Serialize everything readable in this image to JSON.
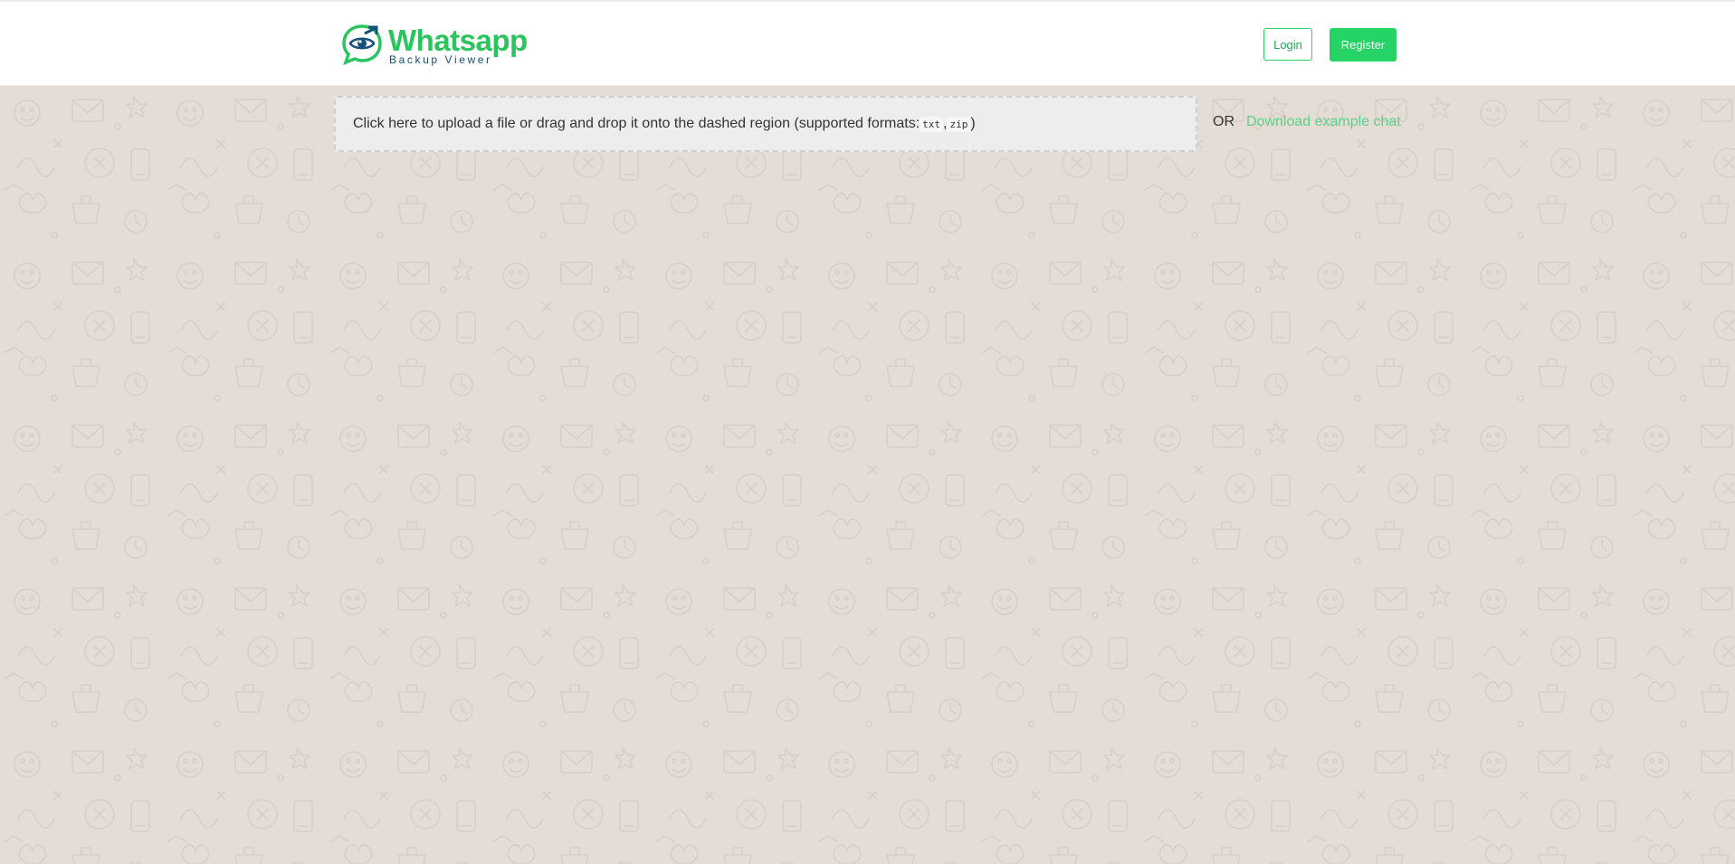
{
  "brand": {
    "title": "Whatsapp",
    "subtitle": "Backup Viewer",
    "logo_icon": "eye-in-chat-bubble-icon",
    "accent_color": "#25d366",
    "dark_color": "#14507a"
  },
  "nav": {
    "login_label": "Login",
    "register_label": "Register"
  },
  "upload": {
    "text": "Click here to upload a file or drag and drop it onto the dashed region (supported formats: ",
    "formats": [
      "txt",
      "zip"
    ],
    "separator": ", ",
    "suffix": ")",
    "or_label": "OR",
    "example_link": "Download example chat"
  },
  "background": {
    "color": "#e5ddd5",
    "pattern": "doodle-wallpaper"
  }
}
